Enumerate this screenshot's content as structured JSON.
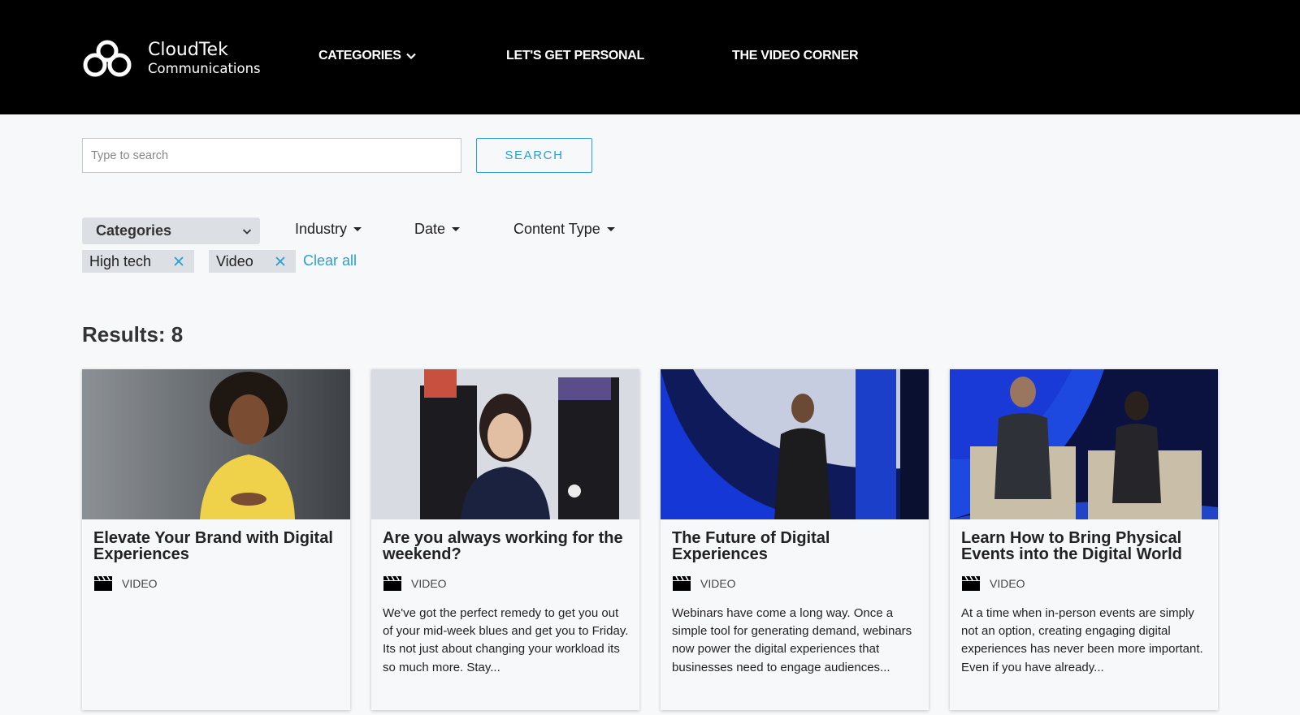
{
  "brand": {
    "name": "CloudTek",
    "subtitle": "Communications"
  },
  "nav": {
    "categories": "CATEGORIES",
    "personal": "LET'S GET PERSONAL",
    "video_corner": "THE VIDEO CORNER"
  },
  "search": {
    "placeholder": "Type to search",
    "button": "SEARCH"
  },
  "filters": {
    "categories": "Categories",
    "industry": "Industry",
    "date": "Date",
    "content_type": "Content Type"
  },
  "active_filters": [
    "High tech",
    "Video"
  ],
  "clear_all": "Clear all",
  "results": "Results: 8",
  "colors": {
    "accent": "#2b9fd1",
    "header_bg": "#000000",
    "chip_bg": "#dcdfe3"
  },
  "cards": [
    {
      "title": "Elevate Your Brand with Digital Experiences",
      "type": "VIDEO",
      "desc": ""
    },
    {
      "title": "Are you always working for the weekend?",
      "type": "VIDEO",
      "desc": "We've got the perfect remedy to get you out of your mid-week blues and get you to Friday. Its not just about changing your workload its so much more. Stay..."
    },
    {
      "title": "The Future of Digital Experiences",
      "type": "VIDEO",
      "desc": "Webinars have come a long way. Once a simple tool for generating demand, webinars now power the digital experiences that businesses need to engage audiences..."
    },
    {
      "title": "Learn How to Bring Physical Events into the Digital World",
      "type": "VIDEO",
      "desc": "At a time when in-person events are simply not an option, creating engaging digital experiences has never been more important. Even if you have already..."
    }
  ]
}
